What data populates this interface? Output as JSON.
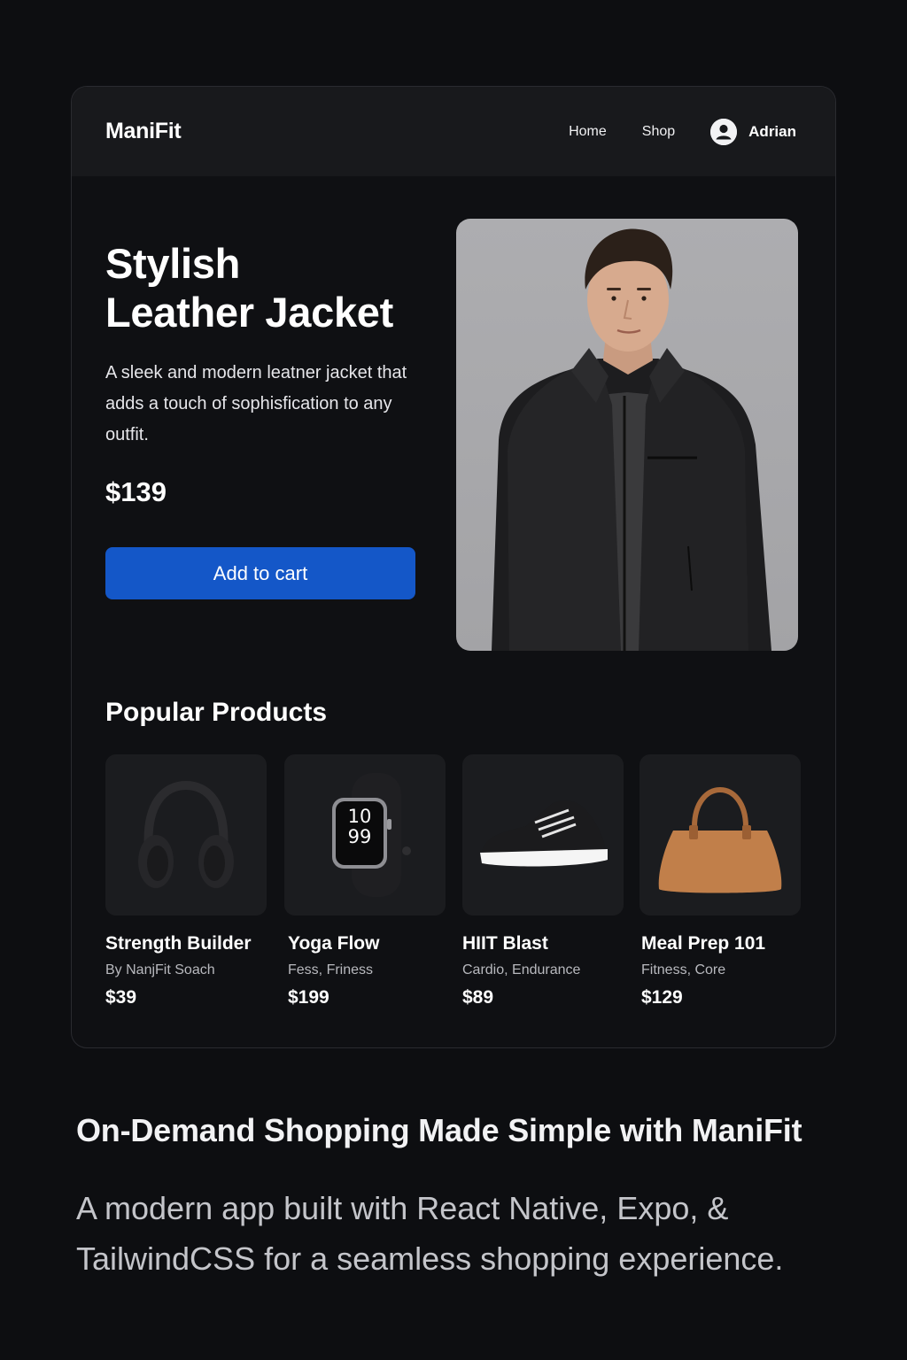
{
  "nav": {
    "logo": "ManiFit",
    "links": [
      "Home",
      "Shop"
    ],
    "user_name": "Adrian"
  },
  "hero": {
    "title_line1": "Stylish",
    "title_line2": "Leather Jacket",
    "description": "A sleek and modern leatner jacket that adds a touch of sophisfication to any outfit.",
    "price": "$139",
    "button_label": "Add to cart",
    "image_icon": "man-in-leather-jacket-photo"
  },
  "popular": {
    "title": "Popular Products",
    "products": [
      {
        "name": "Strength Builder",
        "subtitle": "By NanjFit Soach",
        "price": "$39",
        "icon": "headphones-icon"
      },
      {
        "name": "Yoga Flow",
        "subtitle": "Fess, Friness",
        "price": "$199",
        "icon": "smartwatch-icon",
        "watch_time_hour": "10",
        "watch_time_min": "99"
      },
      {
        "name": "HIIT Blast",
        "subtitle": "Cardio, Endurance",
        "price": "$89",
        "icon": "sneaker-icon"
      },
      {
        "name": "Meal Prep 101",
        "subtitle": "Fitness, Core",
        "price": "$129",
        "icon": "handbag-icon"
      }
    ]
  },
  "marketing": {
    "tagline": "On-Demand Shopping Made Simple with ManiFit",
    "description": "A modern app built with React Native, Expo, & TailwindCSS for a seamless shopping experience."
  },
  "colors": {
    "background": "#0d0e11",
    "card": "#0f1013",
    "nav": "#18191c",
    "accent": "#1457c8"
  }
}
